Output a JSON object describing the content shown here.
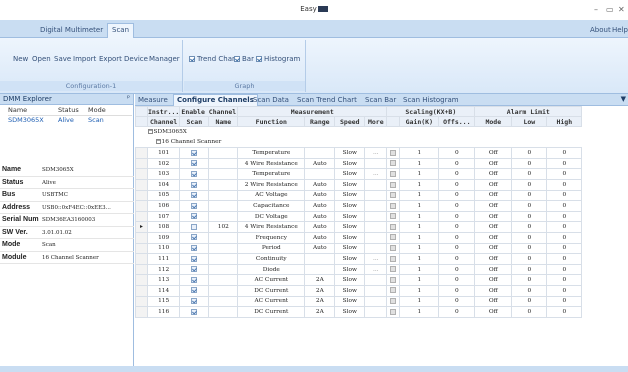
{
  "window": {
    "title": "Easy",
    "minimize": "–",
    "maximize": "▭",
    "close": "✕"
  },
  "tabs": {
    "app_tab": "Digital Multimeter",
    "scan_tab": "Scan",
    "about": "About",
    "help": "Help"
  },
  "ribbon": {
    "config_group": "Configuration-1",
    "graph_group": "Graph",
    "buttons": [
      "New",
      "Open",
      "Save",
      "Import",
      "Export",
      "Device",
      "Manager"
    ],
    "checks": [
      "Trend Chart",
      "Bar",
      "Histogram"
    ]
  },
  "explorer": {
    "title": "DMM Explorer",
    "pin": "ᵖ",
    "headers": [
      "Name",
      "Status",
      "Mode"
    ],
    "device": {
      "name": "SDM3065X",
      "status": "Alive",
      "mode": "Scan"
    },
    "props": [
      {
        "k": "Name",
        "v": "SDM3065X"
      },
      {
        "k": "Status",
        "v": "Alive"
      },
      {
        "k": "Bus",
        "v": "USBTMC"
      },
      {
        "k": "Address",
        "v": "USB0::0xF4EC::0xEE3..."
      },
      {
        "k": "Serial Num",
        "v": "SDM36EA3160003"
      },
      {
        "k": "SW Ver.",
        "v": "3.01.01.02"
      },
      {
        "k": "Mode",
        "v": "Scan"
      },
      {
        "k": "Module",
        "v": "16 Channel Scanner"
      }
    ]
  },
  "doctabs": [
    "Measure",
    "Configure Channels",
    "Scan Data",
    "Scan Trend Chart",
    "Scan Bar",
    "Scan Histogram"
  ],
  "grid": {
    "groups": [
      "Instr...",
      "Enable Channel",
      "Measurement",
      "Scaling(KX+B)",
      "Alarm Limit"
    ],
    "columns": [
      "Channel",
      "Scan",
      "Name",
      "Function",
      "Range",
      "Speed",
      "More",
      "",
      "Gain(K)",
      "Offs...",
      "Mode",
      "Low",
      "High"
    ],
    "tree1": "SDM3065X",
    "tree2": "16 Channel Scanner",
    "rows": [
      {
        "ch": "101",
        "scan": true,
        "name": "",
        "func": "Temperature",
        "range": "",
        "speed": "Slow",
        "more": "...",
        "gain": "1",
        "off": "0",
        "mode": "Off",
        "low": "0",
        "high": "0"
      },
      {
        "ch": "102",
        "scan": true,
        "name": "",
        "func": "4 Wire Resistance",
        "range": "Auto",
        "speed": "Slow",
        "more": "",
        "gain": "1",
        "off": "0",
        "mode": "Off",
        "low": "0",
        "high": "0"
      },
      {
        "ch": "103",
        "scan": true,
        "name": "",
        "func": "Temperature",
        "range": "",
        "speed": "Slow",
        "more": "...",
        "gain": "1",
        "off": "0",
        "mode": "Off",
        "low": "0",
        "high": "0"
      },
      {
        "ch": "104",
        "scan": true,
        "name": "",
        "func": "2 Wire Resistance",
        "range": "Auto",
        "speed": "Slow",
        "more": "",
        "gain": "1",
        "off": "0",
        "mode": "Off",
        "low": "0",
        "high": "0"
      },
      {
        "ch": "105",
        "scan": true,
        "name": "",
        "func": "AC Voltage",
        "range": "Auto",
        "speed": "Slow",
        "more": "",
        "gain": "1",
        "off": "0",
        "mode": "Off",
        "low": "0",
        "high": "0"
      },
      {
        "ch": "106",
        "scan": true,
        "name": "",
        "func": "Capacitance",
        "range": "Auto",
        "speed": "Slow",
        "more": "",
        "gain": "1",
        "off": "0",
        "mode": "Off",
        "low": "0",
        "high": "0"
      },
      {
        "ch": "107",
        "scan": true,
        "name": "",
        "func": "DC Voltage",
        "range": "Auto",
        "speed": "Slow",
        "more": "",
        "gain": "1",
        "off": "0",
        "mode": "Off",
        "low": "0",
        "high": "0"
      },
      {
        "ch": "108",
        "scan": false,
        "name": "102",
        "func": "4 Wire Resistance",
        "range": "Auto",
        "speed": "Slow",
        "more": "",
        "gain": "1",
        "off": "0",
        "mode": "Off",
        "low": "0",
        "high": "0",
        "current": true
      },
      {
        "ch": "109",
        "scan": true,
        "name": "",
        "func": "Frequency",
        "range": "Auto",
        "speed": "Slow",
        "more": "",
        "gain": "1",
        "off": "0",
        "mode": "Off",
        "low": "0",
        "high": "0"
      },
      {
        "ch": "110",
        "scan": true,
        "name": "",
        "func": "Period",
        "range": "Auto",
        "speed": "Slow",
        "more": "",
        "gain": "1",
        "off": "0",
        "mode": "Off",
        "low": "0",
        "high": "0"
      },
      {
        "ch": "111",
        "scan": true,
        "name": "",
        "func": "Continuity",
        "range": "",
        "speed": "Slow",
        "more": "...",
        "gain": "1",
        "off": "0",
        "mode": "Off",
        "low": "0",
        "high": "0"
      },
      {
        "ch": "112",
        "scan": true,
        "name": "",
        "func": "Diode",
        "range": "",
        "speed": "Slow",
        "more": "...",
        "gain": "1",
        "off": "0",
        "mode": "Off",
        "low": "0",
        "high": "0"
      },
      {
        "ch": "113",
        "scan": true,
        "name": "",
        "func": "AC Current",
        "range": "2A",
        "speed": "Slow",
        "more": "",
        "gain": "1",
        "off": "0",
        "mode": "Off",
        "low": "0",
        "high": "0"
      },
      {
        "ch": "114",
        "scan": true,
        "name": "",
        "func": "DC Current",
        "range": "2A",
        "speed": "Slow",
        "more": "",
        "gain": "1",
        "off": "0",
        "mode": "Off",
        "low": "0",
        "high": "0"
      },
      {
        "ch": "115",
        "scan": true,
        "name": "",
        "func": "AC Current",
        "range": "2A",
        "speed": "Slow",
        "more": "",
        "gain": "1",
        "off": "0",
        "mode": "Off",
        "low": "0",
        "high": "0"
      },
      {
        "ch": "116",
        "scan": true,
        "name": "",
        "func": "DC Current",
        "range": "2A",
        "speed": "Slow",
        "more": "",
        "gain": "1",
        "off": "0",
        "mode": "Off",
        "low": "0",
        "high": "0"
      }
    ]
  }
}
